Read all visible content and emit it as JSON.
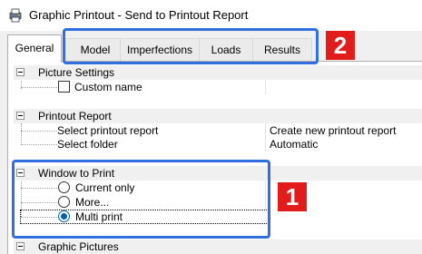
{
  "window": {
    "title": "Graphic Printout - Send to Printout Report"
  },
  "tabs": [
    {
      "label": "General"
    },
    {
      "label": "Model"
    },
    {
      "label": "Imperfections"
    },
    {
      "label": "Loads"
    },
    {
      "label": "Results"
    }
  ],
  "active_tab": "General",
  "tree": {
    "picture_settings": {
      "label": "Picture Settings",
      "custom_name": {
        "label": "Custom name",
        "checked": false
      }
    },
    "printout_report": {
      "label": "Printout Report",
      "select_report": {
        "label": "Select printout report",
        "value": "Create new printout report"
      },
      "select_folder": {
        "label": "Select folder",
        "value": "Automatic"
      }
    },
    "window_to_print": {
      "label": "Window to Print",
      "options": [
        {
          "label": "Current only",
          "selected": false
        },
        {
          "label": "More...",
          "selected": false
        },
        {
          "label": "Multi print",
          "selected": true
        }
      ]
    },
    "graphic_pictures": {
      "label": "Graphic Pictures"
    }
  },
  "callouts": [
    {
      "number": "1",
      "color": "#e21b1b",
      "box_color": "#2f6fe0"
    },
    {
      "number": "2",
      "color": "#e21b1b",
      "box_color": "#2f6fe0"
    }
  ]
}
